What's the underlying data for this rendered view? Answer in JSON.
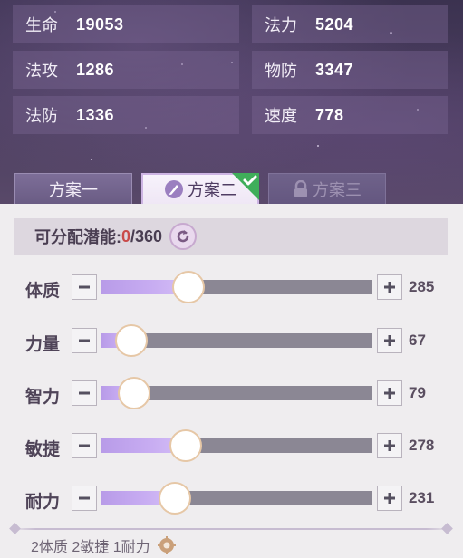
{
  "stats": [
    {
      "label": "生命",
      "value": "19053"
    },
    {
      "label": "法力",
      "value": "5204"
    },
    {
      "label": "法攻",
      "value": "1286"
    },
    {
      "label": "物防",
      "value": "3347"
    },
    {
      "label": "法防",
      "value": "1336"
    },
    {
      "label": "速度",
      "value": "778"
    }
  ],
  "tabs": [
    {
      "label": "方案一",
      "state": "normal"
    },
    {
      "label": "方案二",
      "state": "active",
      "icon": "brush-icon"
    },
    {
      "label": "方案三",
      "state": "locked",
      "icon": "lock-icon"
    }
  ],
  "points": {
    "label": "可分配潜能:",
    "used": "0",
    "total": "/360"
  },
  "attributes": [
    {
      "name": "体质",
      "value": "285",
      "fill_fraction": 0.32
    },
    {
      "name": "力量",
      "value": "67",
      "fill_fraction": 0.11
    },
    {
      "name": "智力",
      "value": "79",
      "fill_fraction": 0.12
    },
    {
      "name": "敏捷",
      "value": "278",
      "fill_fraction": 0.31
    },
    {
      "name": "耐力",
      "value": "231",
      "fill_fraction": 0.27
    }
  ],
  "recommend": "2体质 2敏捷 1耐力",
  "colors": {
    "accent_purple": "#c8adf2",
    "used_points": "#c94a4a",
    "check_green": "#3fae5a"
  }
}
